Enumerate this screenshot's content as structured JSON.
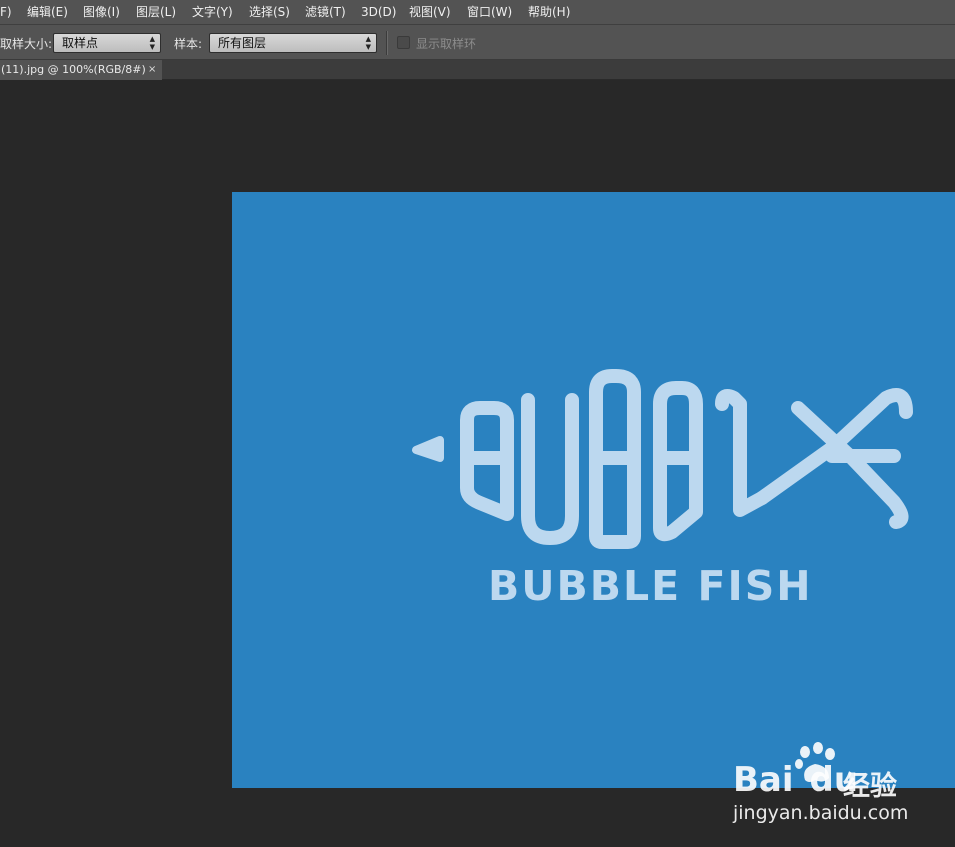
{
  "menubar": {
    "items": [
      {
        "label": "F)"
      },
      {
        "label": "编辑(E)"
      },
      {
        "label": "图像(I)"
      },
      {
        "label": "图层(L)"
      },
      {
        "label": "文字(Y)"
      },
      {
        "label": "选择(S)"
      },
      {
        "label": "滤镜(T)"
      },
      {
        "label": "3D(D)"
      },
      {
        "label": "视图(V)"
      },
      {
        "label": "窗口(W)"
      },
      {
        "label": "帮助(H)"
      }
    ]
  },
  "options": {
    "sample_size_label": "取样大小:",
    "sample_size_value": "取样点",
    "sample_label": "样本:",
    "sample_value": "所有图层",
    "show_ring_label": "显示取样环",
    "show_ring_checked": false
  },
  "document": {
    "tab_title": "(11).jpg @ 100%(RGB/8#)",
    "close_glyph": "×"
  },
  "image": {
    "brand_text": "BUBBLE FISH",
    "background_color": "#2a82c0",
    "logo_color": "#bcd8ef"
  },
  "watermark": {
    "brand": "Bai",
    "brand_suffix": "du",
    "product": "经验",
    "url": "jingyan.baidu.com"
  },
  "icons": {
    "select_arrows": "updown-arrows-icon",
    "paw": "baidu-paw-icon"
  }
}
